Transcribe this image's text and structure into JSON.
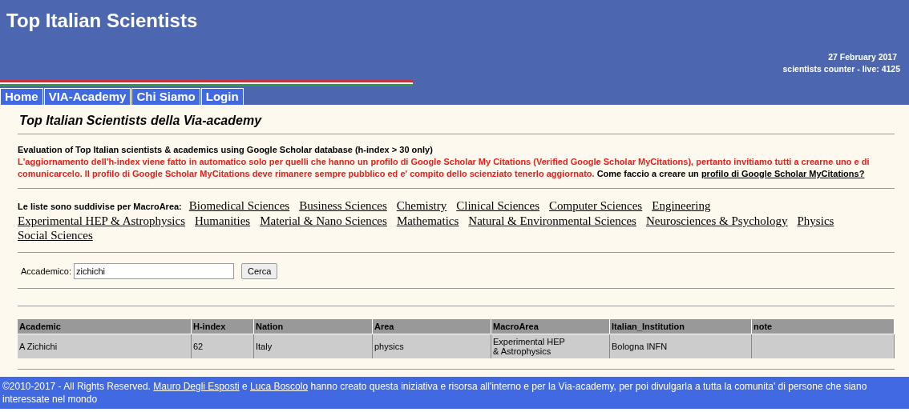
{
  "header": {
    "title": "Top Italian Scientists",
    "date": "27 February 2017",
    "counter": "scientists counter - live: 4125"
  },
  "nav": [
    {
      "label": "Home"
    },
    {
      "label": "VIA-Academy"
    },
    {
      "label": "Chi Siamo"
    },
    {
      "label": "Login"
    }
  ],
  "page_title": "Top Italian Scientists della Via-academy",
  "intro": {
    "heading": "Evaluation of Top Italian scientists & academics using Google Scholar database (h-index > 30 only)",
    "notice": "L'aggiornamento dell'h-index viene fatto in automatico solo per quelli che hanno un profilo di Google Scholar My Citations (Verified Google Scholar MyCitations), pertanto invitiamo tutti a crearne uno e di comunicarcelo. Il profilo di Google Scholar MyCitations deve rimanere sempre pubblico ed e' compito dello scienziato tenerlo aggiornato.",
    "question": "Come faccio a creare un",
    "link": "profilo di Google Scholar MyCitations?"
  },
  "macroareas": {
    "label": "Le liste sono suddivise per MacroArea:",
    "links": [
      "Biomedical Sciences",
      "Business Sciences",
      "Chemistry",
      "Clinical Sciences",
      "Computer Sciences",
      "Engineering",
      "Experimental HEP & Astrophysics",
      "Humanities",
      "Material & Nano Sciences",
      "Mathematics",
      "Natural & Environmental Sciences",
      "Neurosciences & Psychology",
      "Physics",
      "Social Sciences"
    ]
  },
  "search": {
    "label": "Accademico:",
    "value": "zichichi",
    "button": "Cerca"
  },
  "table": {
    "columns": [
      "Academic",
      "H-index",
      "Nation",
      "Area",
      "MacroArea",
      "Italian_Institution",
      "note"
    ],
    "rows": [
      [
        "A Zichichi",
        "62",
        "Italy",
        "physics",
        "Experimental HEP\n& Astrophysics",
        "Bologna INFN",
        ""
      ]
    ]
  },
  "footer": {
    "parts": [
      {
        "kind": "text",
        "text": "©2010-2017 - All Rights Reserved."
      },
      {
        "kind": "link",
        "text": "Mauro Degli Esposti"
      },
      {
        "kind": "text",
        "text": "e"
      },
      {
        "kind": "link",
        "text": "Luca Boscolo"
      },
      {
        "kind": "text",
        "text": "hanno creato questa iniziativa e risorsa all'interno e per la Via-academy, per poi divulgarla a tutta la comunita' di persone che siano interessate nel mondo"
      }
    ]
  }
}
